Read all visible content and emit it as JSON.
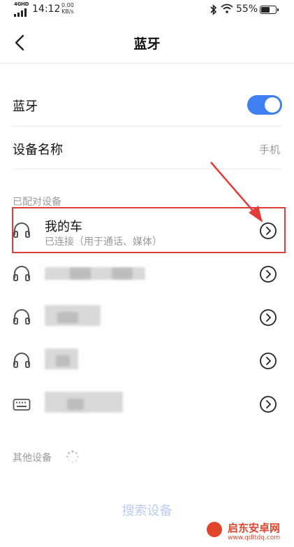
{
  "status_bar": {
    "network": "4GHD",
    "time": "14:12",
    "speed_value": "0.00",
    "speed_unit": "KB/s",
    "battery": "55%"
  },
  "header": {
    "title": "蓝牙"
  },
  "bluetooth_row": {
    "label": "蓝牙",
    "enabled": true,
    "accent": "#3f7ff1"
  },
  "device_name_row": {
    "label": "设备名称",
    "value": "手机"
  },
  "paired_section": {
    "title": "已配对设备",
    "devices": [
      {
        "name": "我的车",
        "status": "已连接（用于通话、媒体）",
        "icon": "headphones-icon"
      },
      {
        "name": "",
        "status": "",
        "icon": "headphones-icon"
      },
      {
        "name": "",
        "status": "",
        "icon": "headphones-icon"
      },
      {
        "name": "",
        "status": "",
        "icon": "headphones-icon"
      },
      {
        "name": "",
        "status": "",
        "icon": "keyboard-icon"
      }
    ]
  },
  "other_section": {
    "title": "其他设备"
  },
  "search_button": {
    "label": "搜索设备"
  },
  "watermark": {
    "name": "启东安卓网",
    "url": "www.qdltdq.com",
    "color": "#e0462e"
  },
  "annotation_color": "#e43a3a"
}
